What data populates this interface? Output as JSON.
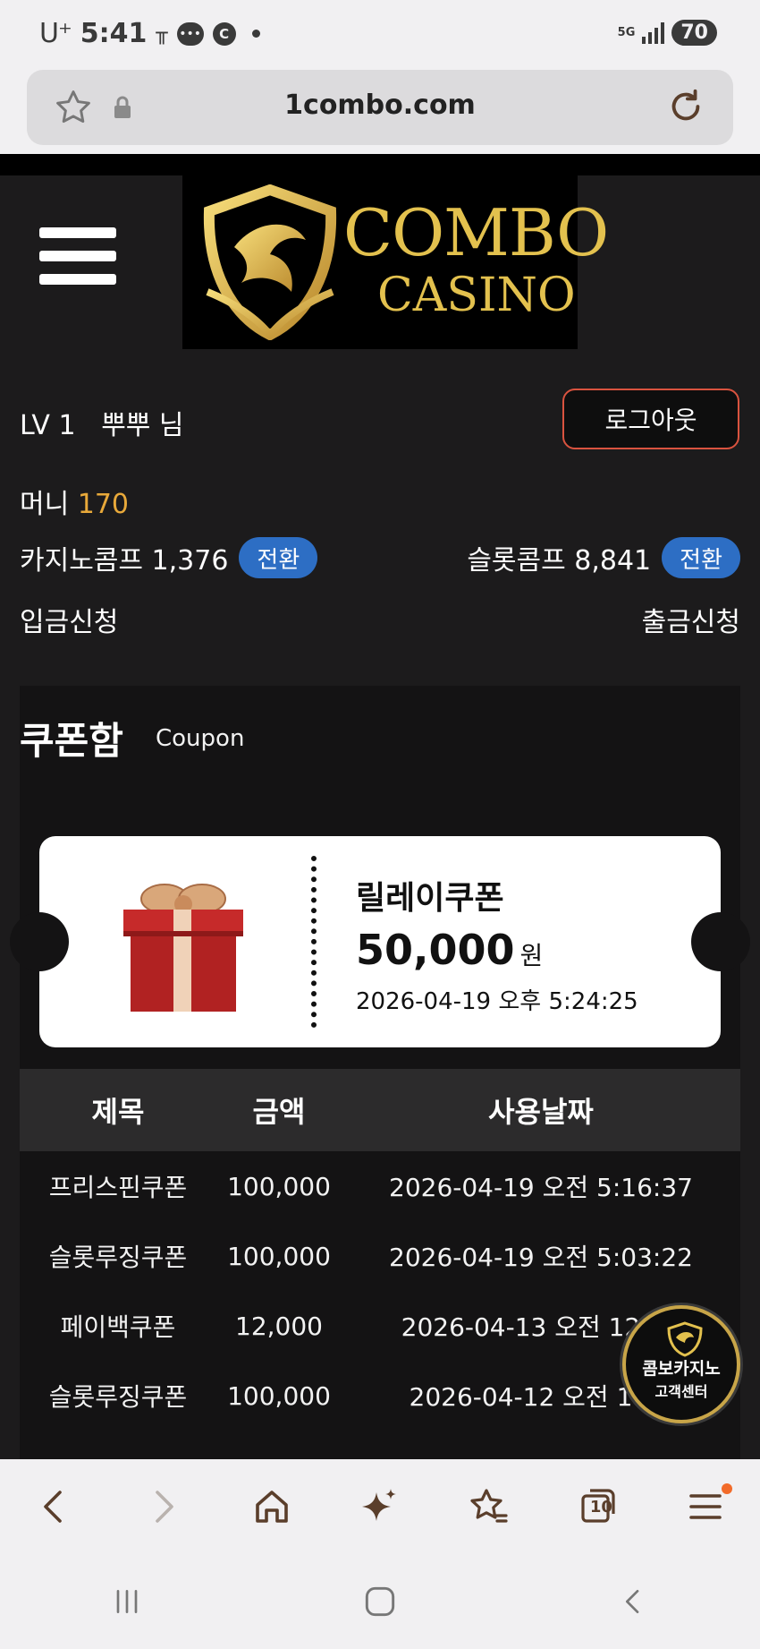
{
  "status_bar": {
    "carrier": "U⁺",
    "time": "5:41",
    "icons": [
      "tmap-icon",
      "chat-bubble-icon",
      "c-circle-icon",
      "dot-icon"
    ],
    "network": "5G",
    "battery": "70"
  },
  "browser": {
    "url": "1combo.com"
  },
  "site": {
    "logo_line1": "COMBO",
    "logo_line2": "CASINO",
    "colors": {
      "gold": "#e3c14e",
      "accent_blue": "#2d6ec4",
      "logout_border": "#d9533f",
      "money": "#e8a93a"
    }
  },
  "user": {
    "level": "LV 1",
    "name": "뿌뿌 님",
    "logout_label": "로그아웃",
    "money_label": "머니",
    "money_value": "170",
    "casino_comp_label": "카지노콤프 1,376",
    "casino_convert_label": "전환",
    "slot_comp_label": "슬롯콤프 8,841",
    "slot_convert_label": "전환",
    "deposit_label": "입금신청",
    "withdraw_label": "출금신청"
  },
  "coupon": {
    "title": "쿠폰함",
    "subtitle": "Coupon",
    "featured": {
      "name": "릴레이쿠폰",
      "amount": "50,000",
      "unit": "원",
      "date": "2026-04-19 오후 5:24:25"
    },
    "table": {
      "headers": [
        "제목",
        "금액",
        "사용날짜"
      ],
      "rows": [
        [
          "프리스핀쿠폰",
          "100,000",
          "2026-04-19 오전 5:16:37"
        ],
        [
          "슬롯루징쿠폰",
          "100,000",
          "2026-04-19 오전 5:03:22"
        ],
        [
          "페이백쿠폰",
          "12,000",
          "2026-04-13 오전 12:30"
        ],
        [
          "슬롯루징쿠폰",
          "100,000",
          "2026-04-12 오전 1:49"
        ]
      ]
    }
  },
  "cs_badge": {
    "line1": "콤보카지노",
    "line2": "고객센터"
  },
  "toolbar": {
    "tabs_count": "10"
  }
}
